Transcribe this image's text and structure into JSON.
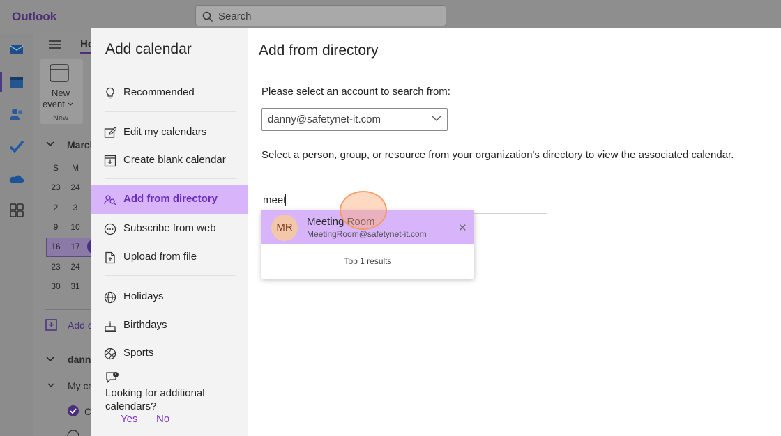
{
  "app": {
    "name": "Outlook"
  },
  "search": {
    "placeholder": "Search"
  },
  "background": {
    "tab_partial": "Ho",
    "new_event": {
      "line1": "New",
      "line2": "event",
      "group": "New"
    },
    "month_partial": "March",
    "weekday_headers": [
      "S",
      "M"
    ],
    "calendar_rows": [
      [
        "23",
        "24"
      ],
      [
        "2",
        "3"
      ],
      [
        "9",
        "10"
      ],
      [
        "16",
        "17"
      ],
      [
        "23",
        "24"
      ],
      [
        "30",
        "31"
      ]
    ],
    "add_calendar_partial": "Add c",
    "account_partial": "danny",
    "my_calendars_partial": "My ca",
    "calendar_item_partial": "C"
  },
  "dialog": {
    "title": "Add calendar",
    "nav": [
      {
        "label": "Recommended",
        "icon": "lightbulb-icon"
      },
      {
        "label": "Edit my calendars",
        "icon": "edit-icon"
      },
      {
        "label": "Create blank calendar",
        "icon": "calendar-add-icon"
      },
      {
        "label": "Add from directory",
        "icon": "people-search-icon",
        "selected": true
      },
      {
        "label": "Subscribe from web",
        "icon": "web-link-icon"
      },
      {
        "label": "Upload from file",
        "icon": "file-upload-icon"
      },
      {
        "label": "Holidays",
        "icon": "globe-icon"
      },
      {
        "label": "Birthdays",
        "icon": "cake-icon"
      },
      {
        "label": "Sports",
        "icon": "sports-ball-icon"
      }
    ],
    "feedback": {
      "question": "Looking for additional calendars?",
      "yes": "Yes",
      "no": "No"
    }
  },
  "panel": {
    "title": "Add from directory",
    "account_prompt": "Please select an account to search from:",
    "account_value": "danny@safetynet-it.com",
    "instruction": "Select a person, group, or resource from your organization's directory to view the associated calendar.",
    "query": "meet",
    "suggestion": {
      "initials": "MR",
      "name": "Meeting Room",
      "email": "MeetingRoom@safetynet-it.com"
    },
    "results_text": "Top 1 results"
  },
  "colors": {
    "accent": "#7b36c7",
    "selected_bg": "#d8b4fa",
    "avatar_bg": "#f3c7aa"
  }
}
